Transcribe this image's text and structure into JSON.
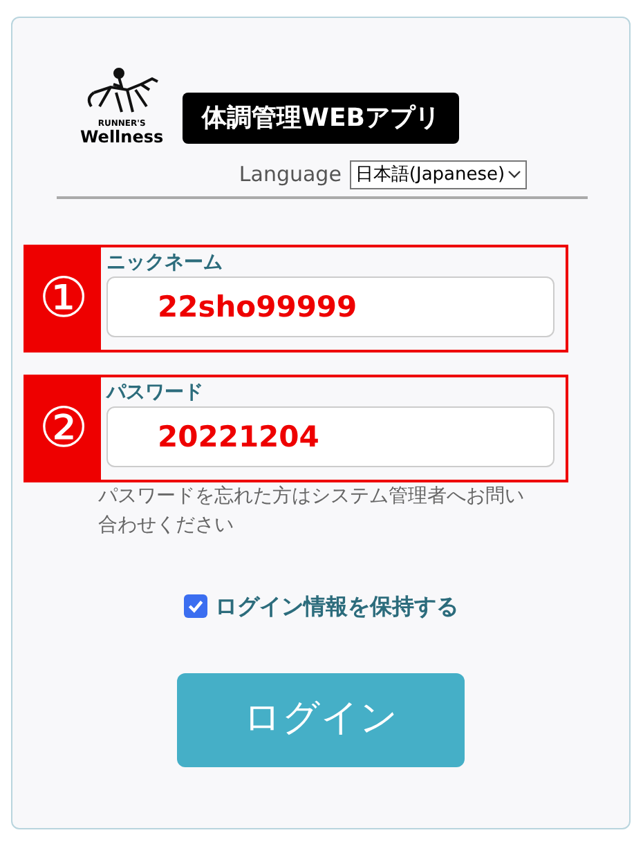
{
  "logo": {
    "tagline": "RUNNER'S",
    "brand": "Wellness"
  },
  "app_title": "体調管理WEBアプリ",
  "language": {
    "label": "Language",
    "value": "日本語(Japanese)"
  },
  "fields": [
    {
      "marker": "①",
      "label": "ニックネーム",
      "value": "22sho99999"
    },
    {
      "marker": "②",
      "label": "パスワード",
      "value": "20221204"
    }
  ],
  "help_text": "パスワードを忘れた方はシステム管理者へお問い合わせください",
  "remember": {
    "label": "ログイン情報を保持する",
    "checked": true
  },
  "login_button": "ログイン"
}
